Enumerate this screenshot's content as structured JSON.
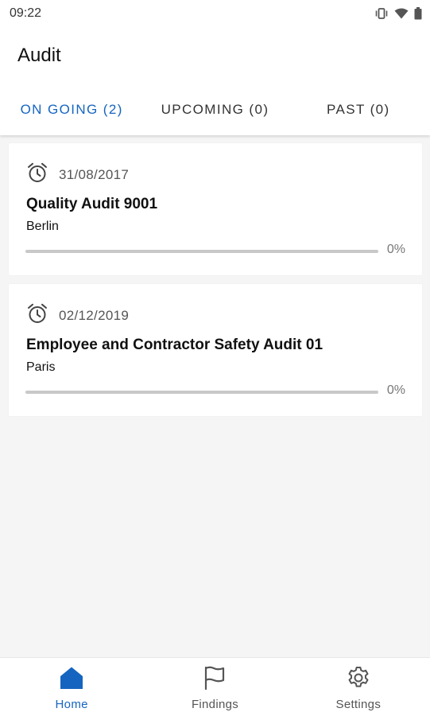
{
  "status_bar": {
    "time": "09:22",
    "icons": [
      "vibrate-icon",
      "wifi-icon",
      "battery-icon"
    ]
  },
  "app": {
    "title": "Audit"
  },
  "tabs": [
    {
      "label": "ON GOING (2)",
      "active": true
    },
    {
      "label": "UPCOMING (0)",
      "active": false
    },
    {
      "label": "PAST (0)",
      "active": false
    }
  ],
  "audits": [
    {
      "date": "31/08/2017",
      "title": "Quality Audit 9001",
      "location": "Berlin",
      "progress_label": "0%",
      "progress": 0
    },
    {
      "date": "02/12/2019",
      "title": "Employee and Contractor Safety Audit 01",
      "location": "Paris",
      "progress_label": "0%",
      "progress": 0
    }
  ],
  "bottom_nav": [
    {
      "label": "Home",
      "icon": "home-icon",
      "active": true
    },
    {
      "label": "Findings",
      "icon": "flag-icon",
      "active": false
    },
    {
      "label": "Settings",
      "icon": "gear-icon",
      "active": false
    }
  ],
  "colors": {
    "accent": "#1565c0",
    "background": "#f5f5f5",
    "card": "#ffffff",
    "progress_track": "#c8c8c8"
  }
}
